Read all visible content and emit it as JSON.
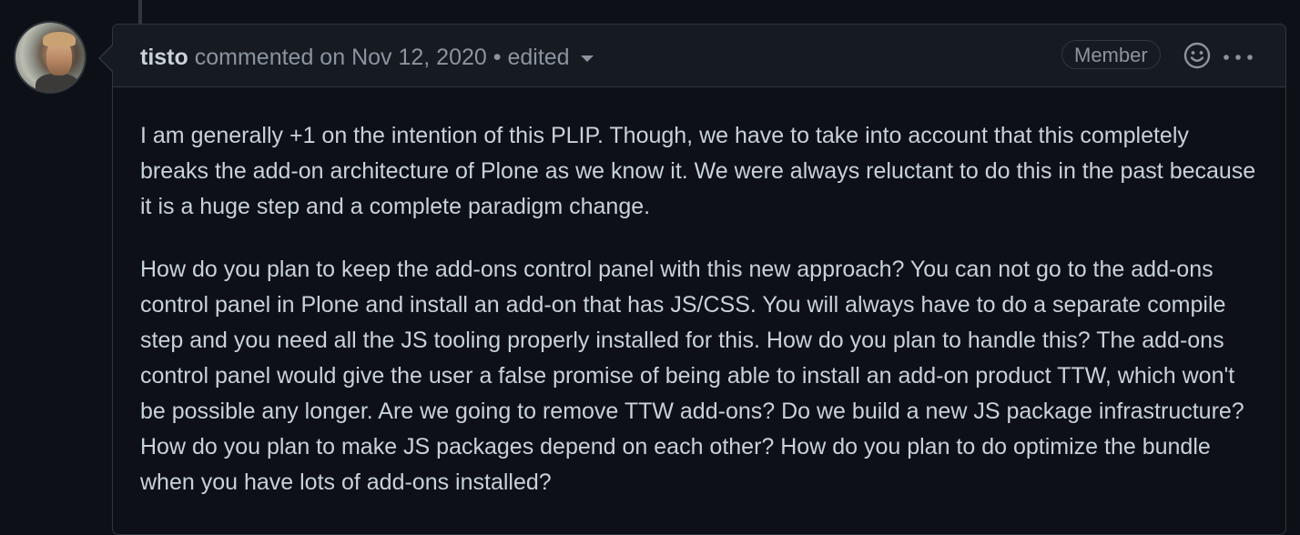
{
  "comment": {
    "author": "tisto",
    "action": "commented on",
    "date": "Nov 12, 2020",
    "separator": "•",
    "edited": "edited",
    "badge": "Member",
    "paragraphs": [
      "I am generally +1 on the intention of this PLIP. Though, we have to take into account that this completely breaks the add-on architecture of Plone as we know it. We were always reluctant to do this in the past because it is a huge step and a complete paradigm change.",
      "How do you plan to keep the add-ons control panel with this new approach? You can not go to the add-ons control panel in Plone and install an add-on that has JS/CSS. You will always have to do a separate compile step and you need all the JS tooling properly installed for this. How do you plan to handle this? The add-ons control panel would give the user a false promise of being able to install an add-on product TTW, which won't be possible any longer. Are we going to remove TTW add-ons? Do we build a new JS package infrastructure? How do you plan to make JS packages depend on each other? How do you plan to do optimize the bundle when you have lots of add-ons installed?"
    ]
  },
  "icons": {
    "reaction": "smiley-icon",
    "menu": "kebab-horizontal-icon",
    "edited_menu": "triangle-down-icon"
  },
  "colors": {
    "background": "#0d1117",
    "header_background": "#161b22",
    "border": "#30363d",
    "text": "#c9d1d9",
    "muted_text": "#8b949e"
  }
}
